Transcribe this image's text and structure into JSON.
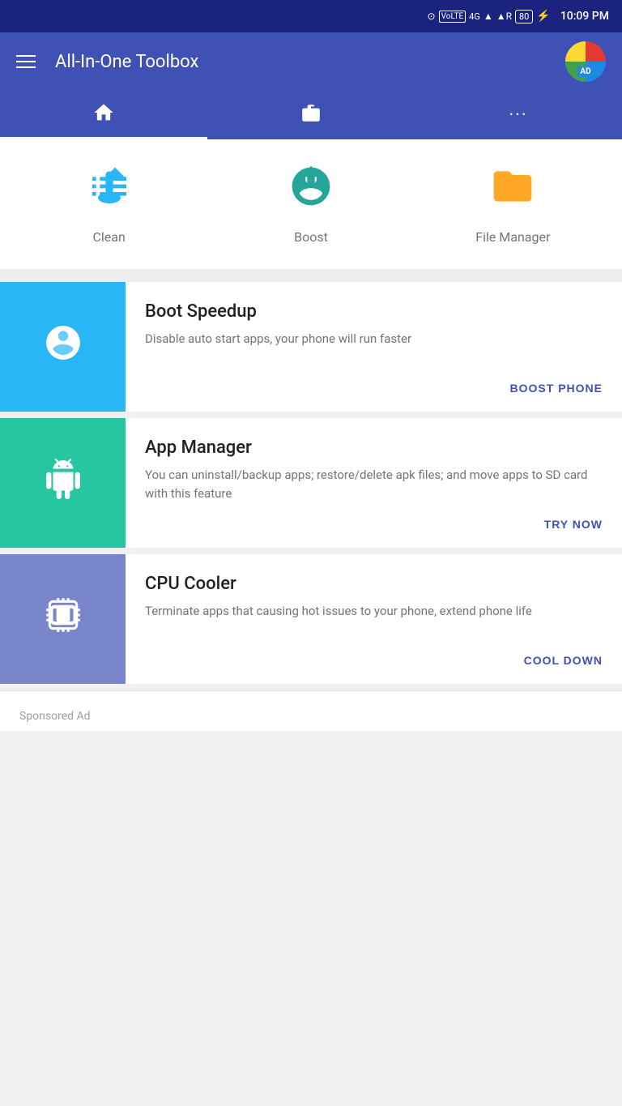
{
  "statusBar": {
    "icons": [
      "⊙",
      "VoLTE",
      "4G",
      "▲",
      "▲R",
      "80",
      "⚡"
    ],
    "time": "10:09 PM"
  },
  "appBar": {
    "title": "All-In-One Toolbox",
    "menuIcon": "menu",
    "adLabel": "AD"
  },
  "tabs": [
    {
      "id": "home",
      "icon": "🏠",
      "label": "Home",
      "active": true
    },
    {
      "id": "briefcase",
      "icon": "💼",
      "label": "Tools",
      "active": false
    },
    {
      "id": "more",
      "icon": "···",
      "label": "More",
      "active": false
    }
  ],
  "quickActions": [
    {
      "id": "clean",
      "icon": "🧹",
      "label": "Clean",
      "color": "#29b6f6"
    },
    {
      "id": "boost",
      "icon": "🚀",
      "label": "Boost",
      "color": "#26a69a"
    },
    {
      "id": "file-manager",
      "icon": "📁",
      "label": "File Manager",
      "color": "#ffa726"
    }
  ],
  "featureCards": [
    {
      "id": "boot-speedup",
      "bgColor": "#29b6f6",
      "title": "Boot Speedup",
      "description": "Disable auto start apps, your phone will run faster",
      "actionLabel": "BOOST PHONE"
    },
    {
      "id": "app-manager",
      "bgColor": "#26c6a0",
      "title": "App Manager",
      "description": "You can uninstall/backup apps; restore/delete apk files; and move apps to SD card with this feature",
      "actionLabel": "TRY NOW"
    },
    {
      "id": "cpu-cooler",
      "bgColor": "#7986cb",
      "title": "CPU Cooler",
      "description": "Terminate apps that causing hot issues to your phone, extend phone life",
      "actionLabel": "COOL DOWN"
    }
  ],
  "sponsored": {
    "label": "Sponsored Ad"
  },
  "colors": {
    "appBarBg": "#3f51b5",
    "statusBarBg": "#1a237e",
    "actionColor": "#3f51b5"
  }
}
